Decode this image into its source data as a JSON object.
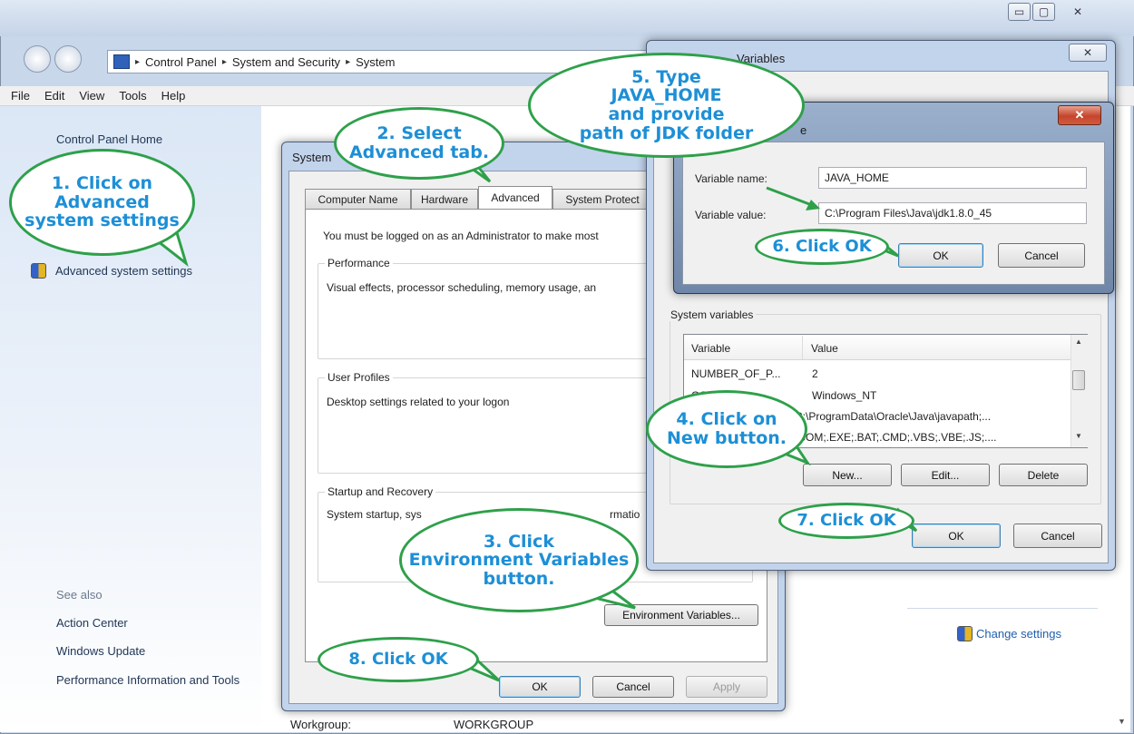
{
  "window": {
    "minimize_glyph": "▭",
    "maximize_glyph": "▢",
    "close_glyph": "✕"
  },
  "address_bar": {
    "breadcrumbs": [
      "Control Panel",
      "System and Security",
      "System"
    ],
    "separator": "▸"
  },
  "menu": [
    "File",
    "Edit",
    "View",
    "Tools",
    "Help"
  ],
  "left_nav": {
    "home": "Control Panel Home",
    "advanced_settings": "Advanced system settings",
    "see_also": "See also",
    "see_also_links": [
      "Action Center",
      "Windows Update",
      "Performance Information and Tools"
    ]
  },
  "content": {
    "workgroup_label": "Workgroup:",
    "workgroup_value": "WORKGROUP",
    "change_settings": "Change settings"
  },
  "system_properties": {
    "title": "System",
    "tabs": [
      "Computer Name",
      "Hardware",
      "Advanced",
      "System Protect"
    ],
    "admin_note": "You must be logged on as an Administrator to make most",
    "performance": {
      "title": "Performance",
      "text": "Visual effects, processor scheduling, memory usage, an"
    },
    "user_profiles": {
      "title": "User Profiles",
      "text": "Desktop settings related to your logon"
    },
    "startup": {
      "title": "Startup and Recovery",
      "text_left": "System startup, sys",
      "text_right": "rmatio"
    },
    "env_button": "Environment Variables...",
    "ok": "OK",
    "cancel": "Cancel",
    "apply": "Apply"
  },
  "env_vars": {
    "title": "Variables",
    "close_glyph": "✕",
    "system_vars_title": "System variables",
    "columns": [
      "Variable",
      "Value"
    ],
    "rows": [
      {
        "variable": "NUMBER_OF_P...",
        "value": "2"
      },
      {
        "variable": "OS",
        "value": "Windows_NT"
      },
      {
        "variable": "",
        "value": "C:\\ProgramData\\Oracle\\Java\\javapath;..."
      },
      {
        "variable": "",
        "value": ".COM;.EXE;.BAT;.CMD;.VBS;.VBE;.JS;...."
      }
    ],
    "new": "New...",
    "edit": "Edit...",
    "delete": "Delete",
    "ok": "OK",
    "cancel": "Cancel"
  },
  "new_var": {
    "title": "e",
    "close_glyph": "✕",
    "name_label": "Variable name:",
    "name_value": "JAVA_HOME",
    "value_label": "Variable value:",
    "value_value": "C:\\Program Files\\Java\\jdk1.8.0_45",
    "ok": "OK",
    "cancel": "Cancel"
  },
  "callouts": {
    "c1": "1. Click on\nAdvanced\nsystem settings",
    "c2": "2. Select\nAdvanced tab.",
    "c3": "3. Click\nEnvironment Variables\nbutton.",
    "c4": "4. Click on\nNew button.",
    "c5": "5. Type\nJAVA_HOME\nand provide\npath of JDK folder",
    "c6": "6. Click OK",
    "c7": "7. Click OK",
    "c8": "8. Click OK"
  },
  "colors": {
    "callout_border": "#2ea04a",
    "callout_text": "#1d8fd6",
    "arrow": "#2ea04a"
  }
}
